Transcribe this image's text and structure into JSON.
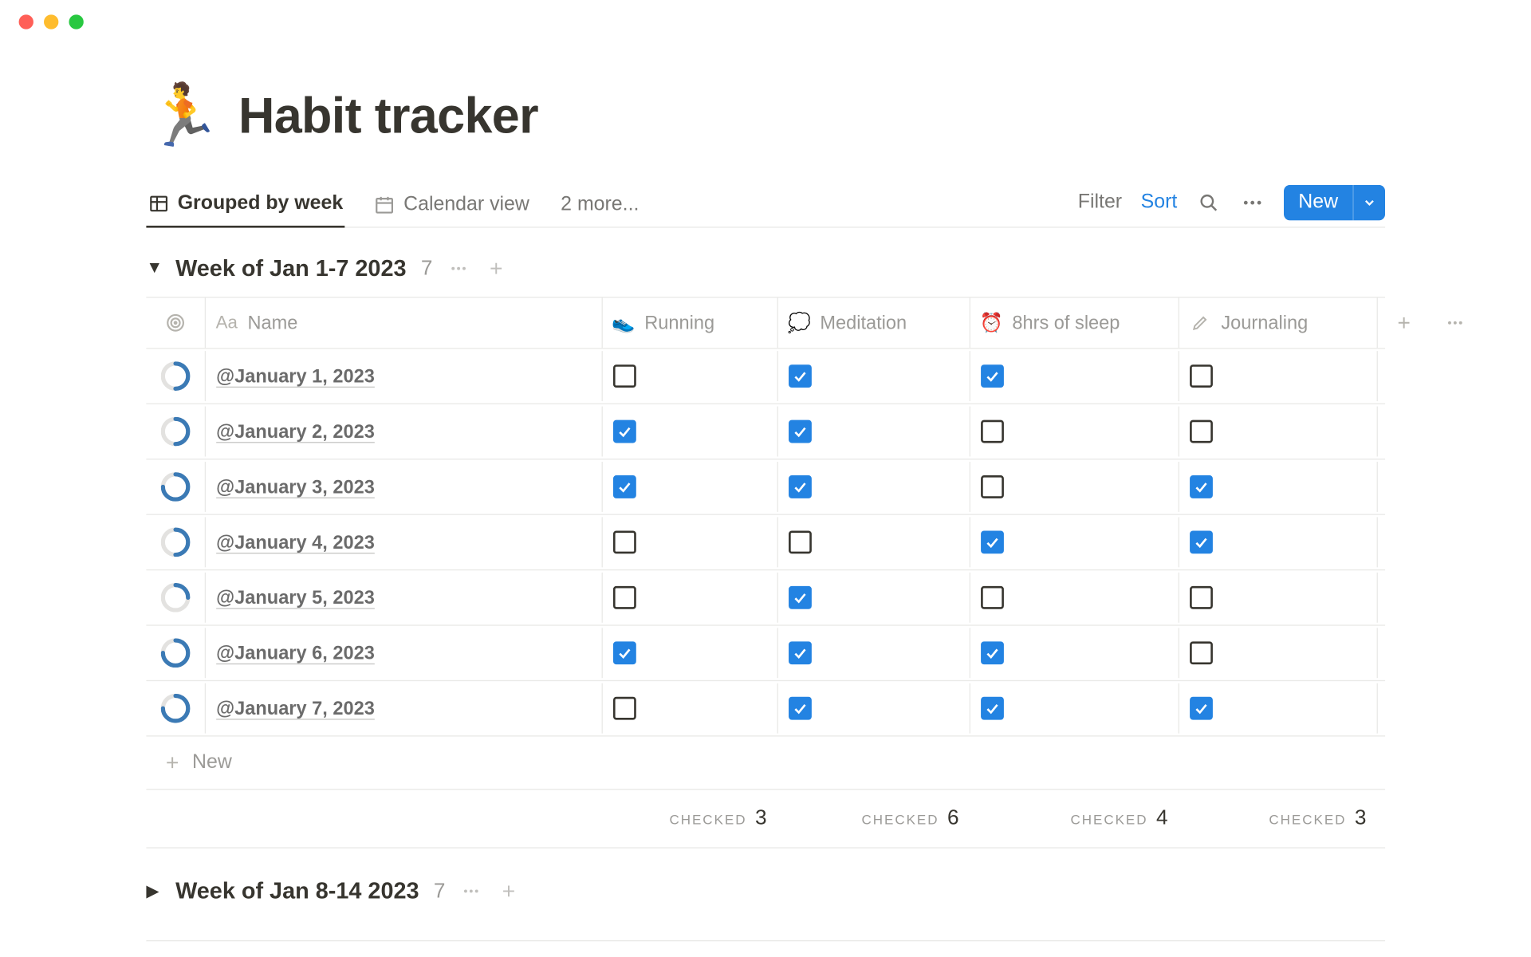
{
  "page": {
    "emoji": "🏃",
    "title": "Habit tracker"
  },
  "views": {
    "tabs": [
      {
        "label": "Grouped by week",
        "active": true
      },
      {
        "label": "Calendar view",
        "active": false
      }
    ],
    "more_label": "2 more..."
  },
  "toolbar": {
    "filter": "Filter",
    "sort": "Sort",
    "new": "New"
  },
  "columns": {
    "name": "Name",
    "running": "Running",
    "meditation": "Meditation",
    "sleep": "8hrs of sleep",
    "journaling": "Journaling"
  },
  "groups": [
    {
      "title": "Week of Jan 1-7 2023",
      "count": "7",
      "expanded": true,
      "rows": [
        {
          "name": "@January 1, 2023",
          "progress": 0.5,
          "running": false,
          "meditation": true,
          "sleep": true,
          "journaling": false
        },
        {
          "name": "@January 2, 2023",
          "progress": 0.5,
          "running": true,
          "meditation": true,
          "sleep": false,
          "journaling": false
        },
        {
          "name": "@January 3, 2023",
          "progress": 0.75,
          "running": true,
          "meditation": true,
          "sleep": false,
          "journaling": true
        },
        {
          "name": "@January 4, 2023",
          "progress": 0.5,
          "running": false,
          "meditation": false,
          "sleep": true,
          "journaling": true
        },
        {
          "name": "@January 5, 2023",
          "progress": 0.25,
          "running": false,
          "meditation": true,
          "sleep": false,
          "journaling": false
        },
        {
          "name": "@January 6, 2023",
          "progress": 0.75,
          "running": true,
          "meditation": true,
          "sleep": true,
          "journaling": false
        },
        {
          "name": "@January 7, 2023",
          "progress": 0.75,
          "running": false,
          "meditation": true,
          "sleep": true,
          "journaling": true
        }
      ],
      "sums": {
        "label": "Checked",
        "running": "3",
        "meditation": "6",
        "sleep": "4",
        "journaling": "3"
      },
      "new_row_label": "New"
    },
    {
      "title": "Week of Jan 8-14 2023",
      "count": "7",
      "expanded": false
    }
  ]
}
